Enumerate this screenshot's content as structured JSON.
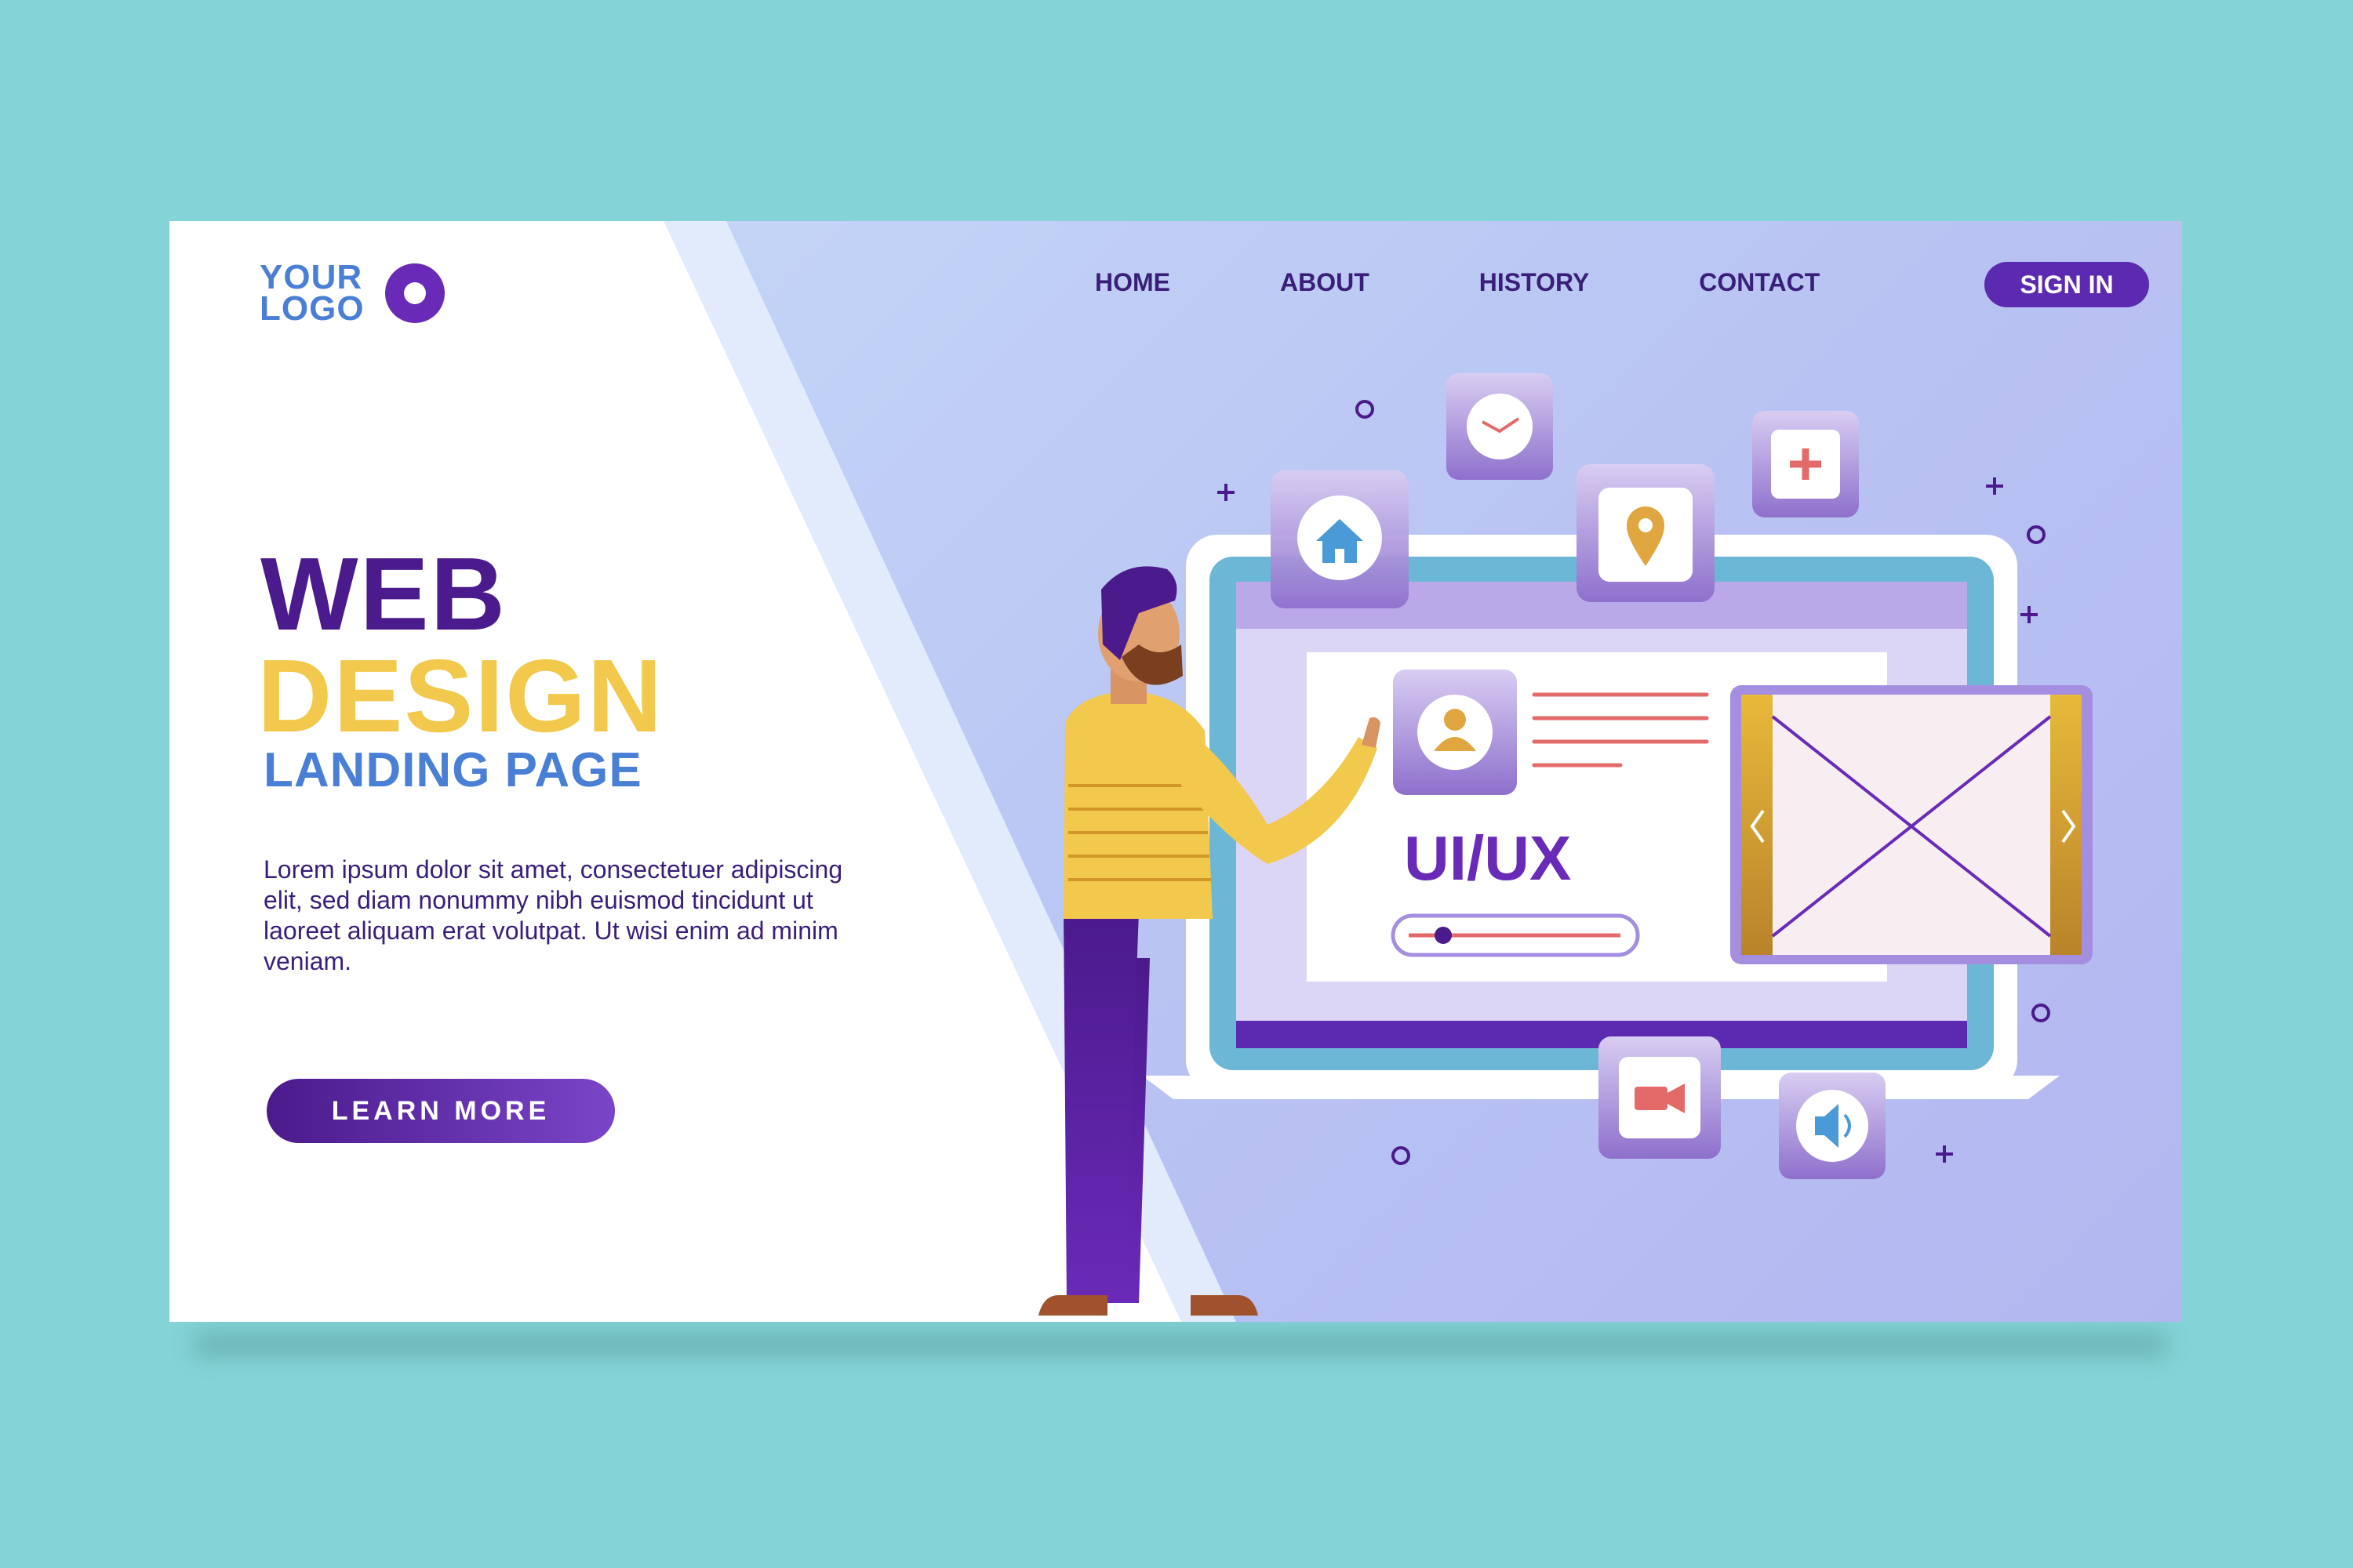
{
  "logo": {
    "line1": "YOUR",
    "line2": "LOGO"
  },
  "nav": {
    "items": [
      {
        "label": "HOME"
      },
      {
        "label": "ABOUT"
      },
      {
        "label": "HISTORY"
      },
      {
        "label": "CONTACT"
      }
    ],
    "signin_label": "SIGN IN"
  },
  "hero": {
    "title_line1": "WEB",
    "title_line2": "DESIGN",
    "subtitle": "LANDING PAGE",
    "body": "Lorem ipsum dolor sit amet, consectetuer adipiscing elit, sed diam nonummy nibh euismod tincidunt ut laoreet aliquam erat volutpat. Ut wisi enim ad minim veniam.",
    "cta_label": "LEARN MORE"
  },
  "illustration": {
    "screen_label": "UI/UX",
    "icons": [
      "home-icon",
      "clock-icon",
      "location-pin-icon",
      "plus-icon",
      "user-icon",
      "video-icon",
      "speaker-icon",
      "image-placeholder-icon"
    ]
  },
  "colors": {
    "background": "#84d3d6",
    "primary": "#4b1a8c",
    "accent_yellow": "#f2c94c",
    "accent_blue": "#4a7fd6",
    "button": "#5c2ab0"
  }
}
